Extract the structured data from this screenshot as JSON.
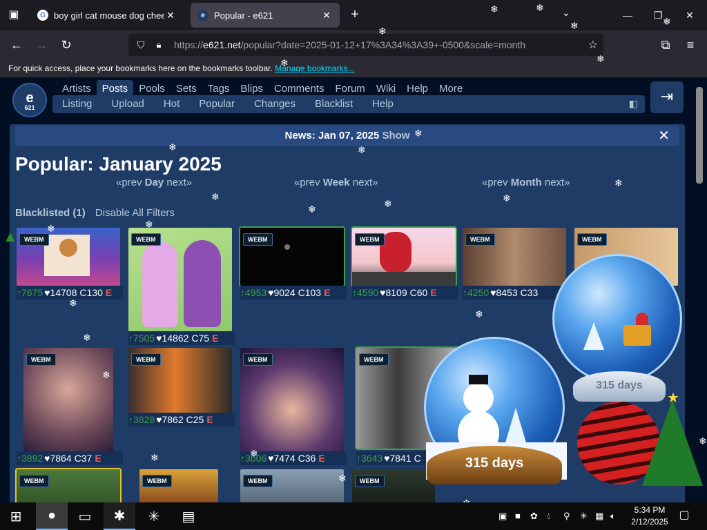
{
  "browser": {
    "tabs": [
      {
        "title": "boy girl cat mouse dog cheese",
        "favicon": "G",
        "active": false
      },
      {
        "title": "Popular - e621",
        "favicon": "e",
        "active": true
      }
    ],
    "url_host": "e621.net",
    "url_scheme": "https://",
    "url_path": "/popular?date=2025-01-12+17%3A34%3A39+-0500&scale=month",
    "bookmarks_text": "For quick access, place your bookmarks here on the bookmarks toolbar.",
    "bookmarks_link": "Manage bookmarks..."
  },
  "site": {
    "logo_letter": "e",
    "logo_sub": "621",
    "main_nav": [
      "Artists",
      "Posts",
      "Pools",
      "Sets",
      "Tags",
      "Blips",
      "Comments",
      "Forum",
      "Wiki",
      "Help",
      "More"
    ],
    "main_nav_active": "Posts",
    "sub_nav": [
      "Listing",
      "Upload",
      "Hot",
      "Popular",
      "Changes",
      "Blacklist",
      "Help"
    ]
  },
  "news": {
    "text": "News: Jan 07, 2025",
    "show": "Show",
    "close": "✕"
  },
  "page_title": "Popular: January 2025",
  "scales": [
    {
      "prev": "«prev",
      "label": "Day",
      "next": "next»"
    },
    {
      "prev": "«prev",
      "label": "Week",
      "next": "next»"
    },
    {
      "prev": "«prev",
      "label": "Month",
      "next": "next»"
    }
  ],
  "blacklist": {
    "label": "Blacklisted (1)",
    "disable": "Disable All Filters"
  },
  "posts": [
    {
      "badge": "WEBM",
      "score": "↑7675",
      "favs": "♥14708",
      "comments": "C130",
      "rating": "E"
    },
    {
      "badge": "WEBM",
      "score": "↑7505",
      "favs": "♥14862",
      "comments": "C75",
      "rating": "E"
    },
    {
      "badge": "WEBM",
      "score": "↑4953",
      "favs": "♥9024",
      "comments": "C103",
      "rating": "E"
    },
    {
      "badge": "WEBM",
      "score": "↑4590",
      "favs": "♥8109",
      "comments": "C60",
      "rating": "E"
    },
    {
      "badge": "WEBM",
      "score": "↑4250",
      "favs": "♥8453",
      "comments": "C33",
      "rating": ""
    },
    {
      "badge": "WEBM",
      "score": "",
      "favs": "",
      "comments": "",
      "rating": ""
    },
    {
      "badge": "WEBM",
      "score": "↑3892",
      "favs": "♥7864",
      "comments": "C37",
      "rating": "E"
    },
    {
      "badge": "WEBM",
      "score": "↑3828",
      "favs": "♥7862",
      "comments": "C25",
      "rating": "E"
    },
    {
      "badge": "WEBM",
      "score": "↑3606",
      "favs": "♥7474",
      "comments": "C36",
      "rating": "E"
    },
    {
      "badge": "WEBM",
      "score": "↑3643",
      "favs": "♥7841",
      "comments": "C",
      "rating": ""
    },
    {
      "badge": "WEBM",
      "score": "",
      "favs": "",
      "comments": "",
      "rating": ""
    },
    {
      "badge": "WEBM",
      "score": "",
      "favs": "",
      "comments": "",
      "rating": ""
    },
    {
      "badge": "WEBM",
      "score": "",
      "favs": "",
      "comments": "",
      "rating": ""
    },
    {
      "badge": "WEBM",
      "score": "",
      "favs": "",
      "comments": "",
      "rating": ""
    }
  ],
  "overlay": {
    "days_small": "315 days",
    "days_large": "315 days"
  },
  "taskbar": {
    "time": "5:34 PM",
    "date": "2/12/2025"
  },
  "colors": {
    "page_bg": "#020f23",
    "panel": "#1f3c67",
    "score_green": "#3e9e49",
    "rating_red": "#e45f5f"
  }
}
